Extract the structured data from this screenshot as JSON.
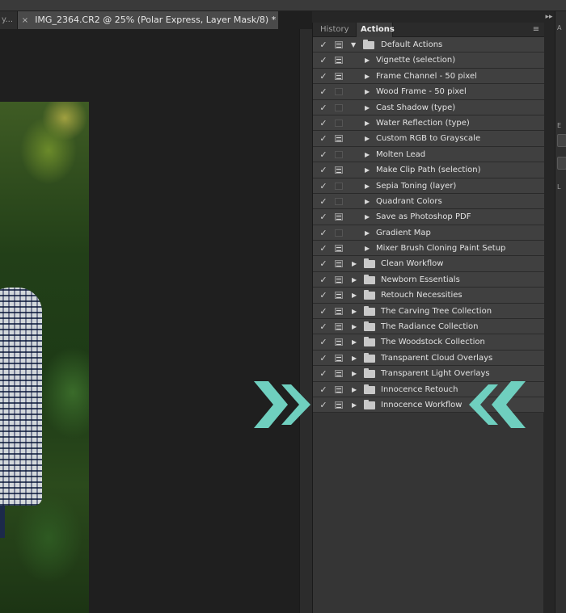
{
  "document": {
    "prev_tab_label": "y...",
    "active_tab_close": "×",
    "active_tab_title": "IMG_2364.CR2 @ 25% (Polar Express, Layer Mask/8) *"
  },
  "panel": {
    "collapse_glyph": "▸▸",
    "tabs": [
      {
        "label": "History",
        "active": false
      },
      {
        "label": "Actions",
        "active": true
      }
    ],
    "menu_glyph": "≡"
  },
  "actions": [
    {
      "type": "top",
      "checked": true,
      "dialog": true,
      "expanded": true,
      "label": "Default Actions"
    },
    {
      "type": "child",
      "checked": true,
      "dialog": true,
      "label": "Vignette (selection)"
    },
    {
      "type": "child",
      "checked": true,
      "dialog": true,
      "label": "Frame Channel - 50 pixel"
    },
    {
      "type": "child",
      "checked": true,
      "dialog": false,
      "label": "Wood Frame - 50 pixel"
    },
    {
      "type": "child",
      "checked": true,
      "dialog": false,
      "label": "Cast Shadow (type)"
    },
    {
      "type": "child",
      "checked": true,
      "dialog": false,
      "label": "Water Reflection (type)"
    },
    {
      "type": "child",
      "checked": true,
      "dialog": true,
      "label": "Custom RGB to Grayscale"
    },
    {
      "type": "child",
      "checked": true,
      "dialog": false,
      "label": "Molten Lead"
    },
    {
      "type": "child",
      "checked": true,
      "dialog": true,
      "label": "Make Clip Path (selection)"
    },
    {
      "type": "child",
      "checked": true,
      "dialog": false,
      "label": "Sepia Toning (layer)"
    },
    {
      "type": "child",
      "checked": true,
      "dialog": false,
      "label": "Quadrant Colors"
    },
    {
      "type": "child",
      "checked": true,
      "dialog": true,
      "label": "Save as Photoshop PDF"
    },
    {
      "type": "child",
      "checked": true,
      "dialog": false,
      "label": "Gradient Map"
    },
    {
      "type": "child",
      "checked": true,
      "dialog": true,
      "label": "Mixer Brush Cloning Paint Setup"
    },
    {
      "type": "set",
      "checked": true,
      "dialog": true,
      "label": "Clean Workflow"
    },
    {
      "type": "set",
      "checked": true,
      "dialog": true,
      "label": "Newborn Essentials"
    },
    {
      "type": "set",
      "checked": true,
      "dialog": true,
      "label": "Retouch Necessities"
    },
    {
      "type": "set",
      "checked": true,
      "dialog": true,
      "label": "The Carving Tree Collection"
    },
    {
      "type": "set",
      "checked": true,
      "dialog": true,
      "label": "The Radiance Collection"
    },
    {
      "type": "set",
      "checked": true,
      "dialog": true,
      "label": "The Woodstock Collection"
    },
    {
      "type": "set",
      "checked": true,
      "dialog": true,
      "label": "Transparent Cloud Overlays"
    },
    {
      "type": "set",
      "checked": true,
      "dialog": true,
      "label": "Transparent Light Overlays"
    },
    {
      "type": "set",
      "checked": true,
      "dialog": true,
      "label": "Innocence Retouch"
    },
    {
      "type": "set",
      "checked": true,
      "dialog": true,
      "label": "Innocence Workflow"
    }
  ],
  "colors": {
    "highlight_arrows": "#6fcfbf",
    "panel_bg": "#353535",
    "row_bg": "#404040"
  },
  "icons": {
    "check": "✓",
    "expanded_triangle": "▼",
    "collapsed_triangle": "▶"
  }
}
